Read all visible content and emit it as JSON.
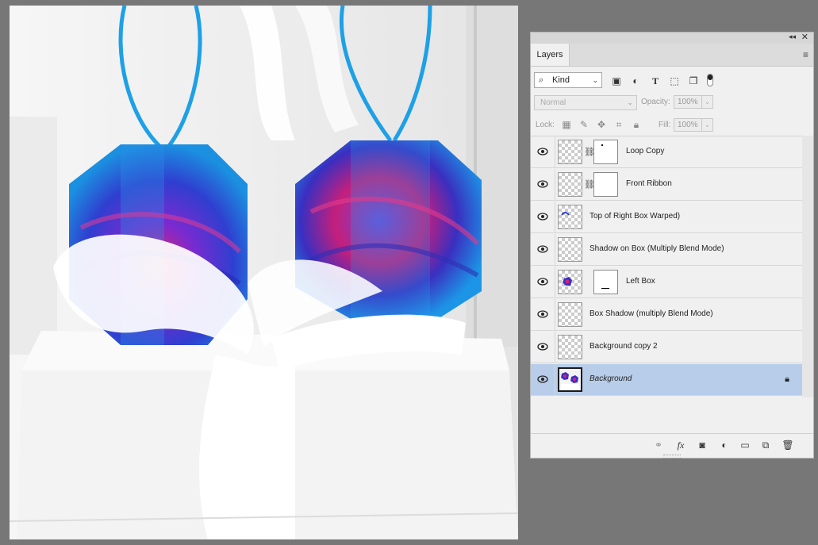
{
  "document": {
    "image_description": "",
    "colors": {
      "ornament_blue": "#2f3fd0",
      "ornament_pink": "#d01a78",
      "ribbon_blue": "#1ea0e6",
      "box_white": "#f2f2f2"
    }
  },
  "panel": {
    "tab_label": "Layers",
    "icons": {
      "collapse": "collapse-icon",
      "close": "close-icon",
      "menu": "panel-menu-icon"
    },
    "filter": {
      "kind_label": "Kind",
      "icons": [
        "image-filter-icon",
        "adjustment-filter-icon",
        "type-filter-icon",
        "shape-filter-icon",
        "smart-object-filter-icon"
      ]
    },
    "blend_mode": "Normal",
    "opacity_label": "Opacity:",
    "opacity_value": "100%",
    "lock_label": "Lock:",
    "lock_icons": [
      "lock-transparent-icon",
      "lock-image-icon",
      "lock-position-icon",
      "lock-artboard-icon",
      "lock-all-icon"
    ],
    "fill_label": "Fill:",
    "fill_value": "100%",
    "layers": [
      {
        "name": "Loop Copy",
        "visible": true,
        "has_mask": true,
        "linked": true,
        "thumb": "transparent",
        "italic": false,
        "selected": false
      },
      {
        "name": "Front Ribbon",
        "visible": true,
        "has_mask": true,
        "linked": true,
        "thumb": "transparent",
        "italic": false,
        "selected": false
      },
      {
        "name": "Top of Right Box Warped)",
        "visible": true,
        "has_mask": false,
        "linked": false,
        "thumb": "transparent-blue-stroke",
        "italic": false,
        "selected": false
      },
      {
        "name": "Shadow on Box (Multiply Blend Mode)",
        "visible": true,
        "has_mask": false,
        "linked": false,
        "thumb": "transparent",
        "italic": false,
        "selected": false
      },
      {
        "name": "Left Box",
        "visible": true,
        "has_mask": true,
        "linked": false,
        "thumb": "ornament",
        "italic": false,
        "selected": false
      },
      {
        "name": "Box Shadow (multiply Blend Mode)",
        "visible": true,
        "has_mask": false,
        "linked": false,
        "thumb": "transparent",
        "italic": false,
        "selected": false
      },
      {
        "name": "Background copy 2",
        "visible": true,
        "has_mask": false,
        "linked": false,
        "thumb": "transparent",
        "italic": false,
        "selected": false
      },
      {
        "name": "Background",
        "visible": true,
        "has_mask": false,
        "linked": false,
        "thumb": "photo",
        "italic": true,
        "selected": true,
        "locked": true
      }
    ],
    "footer_icons": [
      "link-layers-icon",
      "fx-icon",
      "add-mask-icon",
      "adjustment-layer-icon",
      "new-group-icon",
      "new-layer-icon",
      "trash-icon"
    ]
  }
}
